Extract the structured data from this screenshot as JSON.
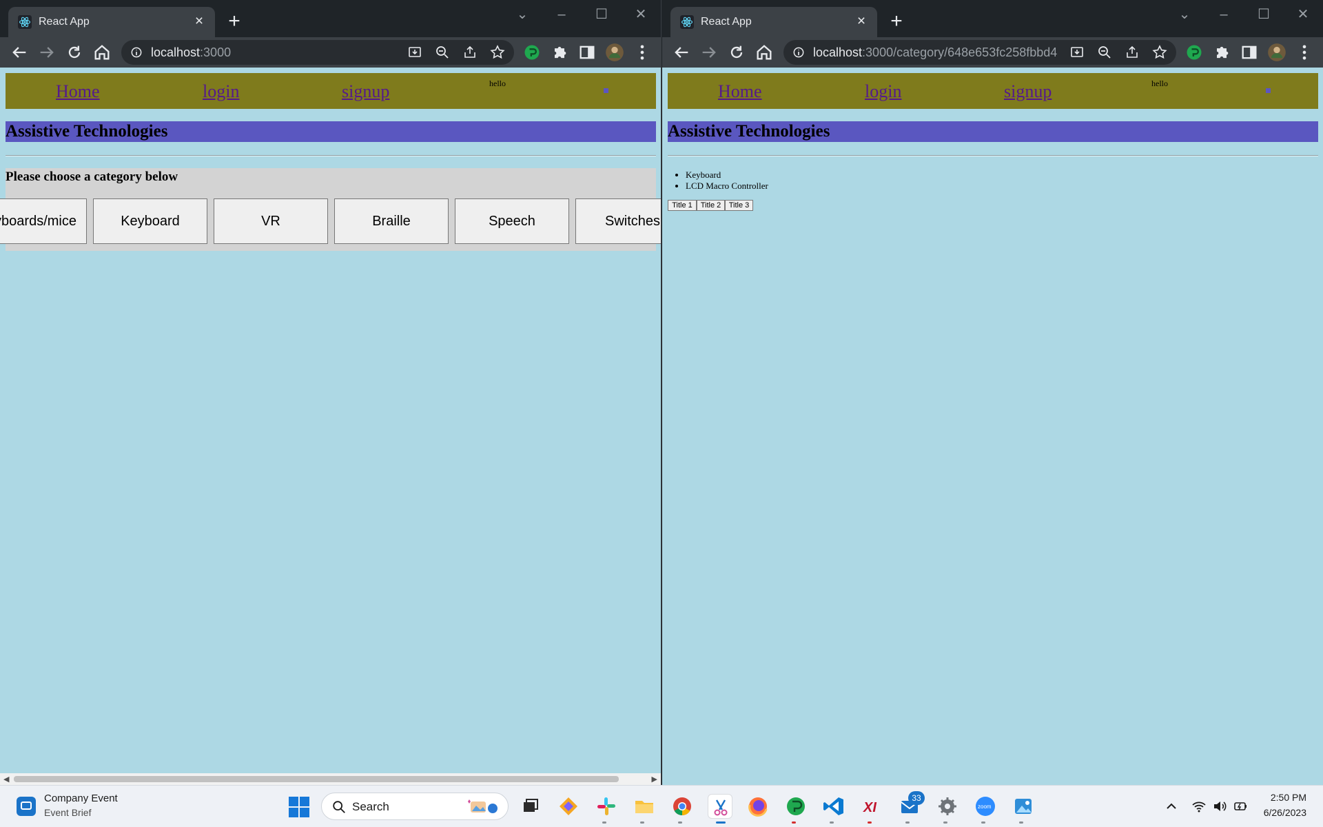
{
  "browser_left": {
    "tab_title": "React App",
    "url_host": "localhost",
    "url_rest": ":3000"
  },
  "browser_right": {
    "tab_title": "React App",
    "url_host": "localhost",
    "url_rest": ":3000/category/648e653fc258fbbd4..."
  },
  "page_left": {
    "nav": {
      "home": "Home",
      "login": "login",
      "signup": "signup",
      "hello": "hello"
    },
    "site_title": "Assistive Technologies",
    "category_heading": "Please choose a category below",
    "categories": [
      "Keyboards/mice",
      "Keyboard",
      "VR",
      "Braille",
      "Speech",
      "Switches"
    ]
  },
  "page_right": {
    "nav": {
      "home": "Home",
      "login": "login",
      "signup": "signup",
      "hello": "hello"
    },
    "site_title": "Assistive Technologies",
    "items": [
      "Keyboard",
      "LCD Macro Controller"
    ],
    "buttons": [
      "Title 1",
      "Title 2",
      "Title 3"
    ]
  },
  "taskbar": {
    "widget_title": "Company Event",
    "widget_subtitle": "Event Brief",
    "search_label": "Search",
    "mail_badge": "33",
    "clock_time": "2:50 PM",
    "clock_date": "6/26/2023"
  },
  "colors": {
    "page_background": "#add8e4",
    "navbar": "#7f7b1c",
    "title_bar": "#5a57c0",
    "category_panel": "#d3d3d3",
    "link": "#551a8b"
  }
}
